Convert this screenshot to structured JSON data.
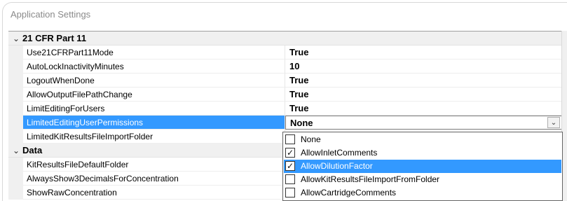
{
  "window": {
    "title": "Application Settings"
  },
  "categories": [
    {
      "label": "21 CFR Part 11",
      "properties": [
        {
          "name": "Use21CFRPart11Mode",
          "value": "True"
        },
        {
          "name": "AutoLockInactivityMinutes",
          "value": "10"
        },
        {
          "name": "LogoutWhenDone",
          "value": "True"
        },
        {
          "name": "AllowOutputFilePathChange",
          "value": "True"
        },
        {
          "name": "LimitEditingForUsers",
          "value": "True"
        },
        {
          "name": "LimitedEditingUserPermissions",
          "value": "None",
          "selected": true
        },
        {
          "name": "LimitedKitResultsFileImportFolder",
          "value": ""
        }
      ]
    },
    {
      "label": "Data",
      "properties": [
        {
          "name": "KitResultsFileDefaultFolder",
          "value": ""
        },
        {
          "name": "AlwaysShow3DecimalsForConcentration",
          "value": ""
        },
        {
          "name": "ShowRawConcentration",
          "value": ""
        }
      ]
    }
  ],
  "dropdown": {
    "items": [
      {
        "label": "None",
        "checked": false
      },
      {
        "label": "AllowInletComments",
        "checked": true
      },
      {
        "label": "AllowDilutionFactor",
        "checked": true,
        "highlighted": true
      },
      {
        "label": "AllowKitResultsFileImportFromFolder",
        "checked": false
      },
      {
        "label": "AllowCartridgeComments",
        "checked": false
      }
    ]
  },
  "colors": {
    "selection": "#3399ff",
    "category_bg": "#f0f0f0"
  },
  "icons": {
    "expand": "chevron-down-icon",
    "dropdown": "dropdown-arrow-icon",
    "check": "checkmark-icon"
  }
}
